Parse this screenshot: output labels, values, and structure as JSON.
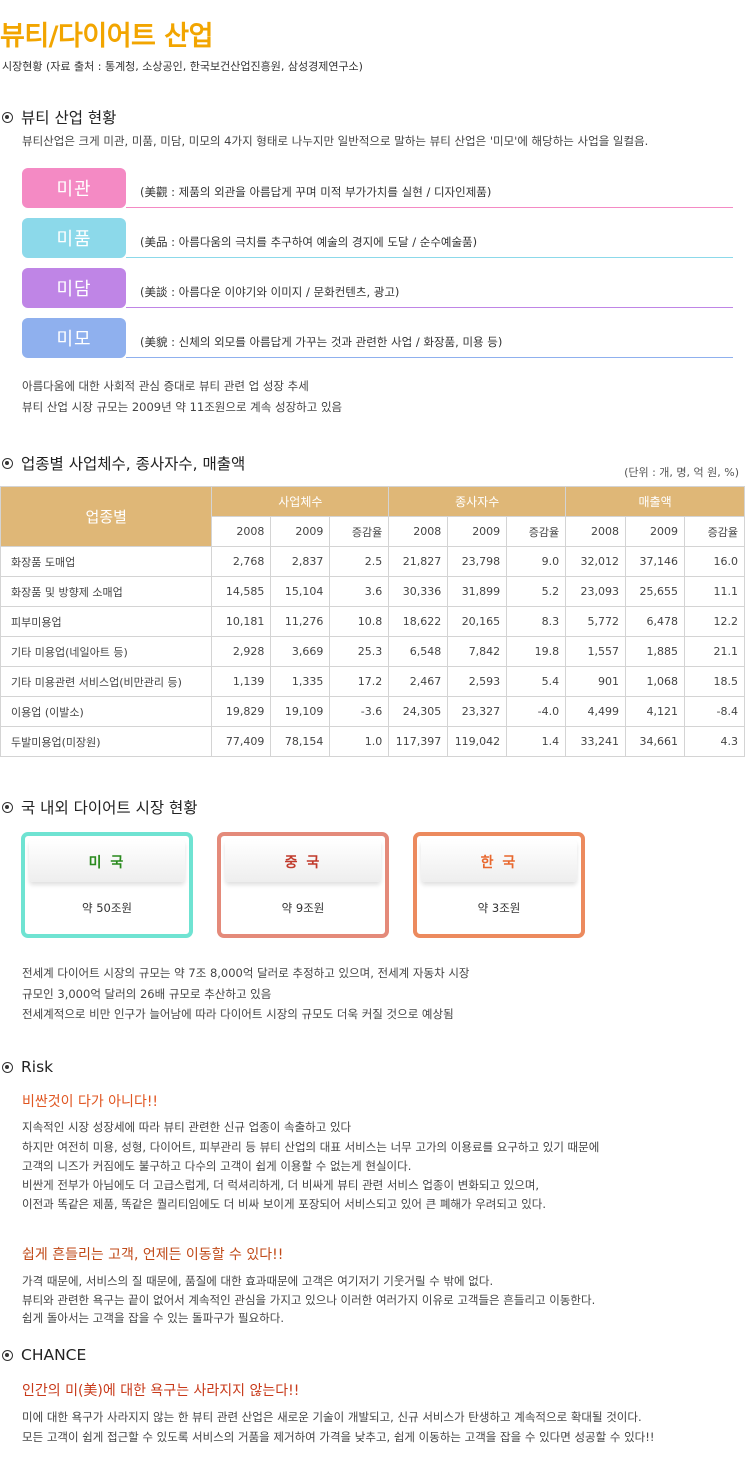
{
  "title": "뷰티/다이어트 산업",
  "subtitle": "시장현황 (자료 출처 : 통계청, 소상공인, 한국보건산업진흥원, 삼성경제연구소)",
  "beauty": {
    "heading": "뷰티 산업 현황",
    "intro": "뷰티산업은 크게 미관, 미품, 미담, 미모의 4가지 형태로 나누지만 일반적으로 말하는 뷰티 산업은 '미모'에 해당하는 사업을 일컬음.",
    "items": [
      {
        "label": "미관",
        "desc": "(美觀 : 제품의 외관을 아름답게 꾸며 미적 부가가치를 실현 / 디자인제품)",
        "color": "#f48ac4"
      },
      {
        "label": "미품",
        "desc": "(美品 : 아름다움의 극치를 추구하여 예술의 경지에 도달 / 순수예술품)",
        "color": "#8cd9ea"
      },
      {
        "label": "미담",
        "desc": "(美談 : 아름다운 이야기와 이미지 / 문화컨텐츠, 광고)",
        "color": "#bf85e6"
      },
      {
        "label": "미모",
        "desc": "(美貌 : 신체의 외모를 아름답게 가꾸는 것과 관련한 사업 / 화장품, 미용 등)",
        "color": "#8fb0ee"
      }
    ],
    "notes": [
      "아름다움에 대한 사회적 관심 증대로 뷰티 관련 업 성장 추세",
      "뷰티 산업 시장 규모는 2009년 약 11조원으로 계속 성장하고 있음"
    ]
  },
  "stats": {
    "heading": "업종별 사업체수, 종사자수, 매출액",
    "unit": "(단위 : 개, 명, 억 원, %)",
    "col_main": "업종별",
    "groups": [
      "사업체수",
      "종사자수",
      "매출액"
    ],
    "subcols": [
      "2008",
      "2009",
      "증감율",
      "2008",
      "2009",
      "증감율",
      "2008",
      "2009",
      "증감율"
    ],
    "rows": [
      {
        "name": "화장품 도매업",
        "v": [
          "2,768",
          "2,837",
          "2.5",
          "21,827",
          "23,798",
          "9.0",
          "32,012",
          "37,146",
          "16.0"
        ]
      },
      {
        "name": "화장품 및 방향제 소매업",
        "v": [
          "14,585",
          "15,104",
          "3.6",
          "30,336",
          "31,899",
          "5.2",
          "23,093",
          "25,655",
          "11.1"
        ]
      },
      {
        "name": "피부미용업",
        "v": [
          "10,181",
          "11,276",
          "10.8",
          "18,622",
          "20,165",
          "8.3",
          "5,772",
          "6,478",
          "12.2"
        ]
      },
      {
        "name": "기타 미용업(네일아트 등)",
        "v": [
          "2,928",
          "3,669",
          "25.3",
          "6,548",
          "7,842",
          "19.8",
          "1,557",
          "1,885",
          "21.1"
        ]
      },
      {
        "name": "기타 미용관련 서비스업(비만관리 등)",
        "v": [
          "1,139",
          "1,335",
          "17.2",
          "2,467",
          "2,593",
          "5.4",
          "901",
          "1,068",
          "18.5"
        ]
      },
      {
        "name": "이용업 (이발소)",
        "v": [
          "19,829",
          "19,109",
          "-3.6",
          "24,305",
          "23,327",
          "-4.0",
          "4,499",
          "4,121",
          "-8.4"
        ]
      },
      {
        "name": "두발미용업(미장원)",
        "v": [
          "77,409",
          "78,154",
          "1.0",
          "117,397",
          "119,042",
          "1.4",
          "33,241",
          "34,661",
          "4.3"
        ]
      }
    ]
  },
  "diet": {
    "heading": "국 내외 다이어트 시장 현황",
    "cards": [
      {
        "name": "미 국",
        "value": "약 50조원",
        "border": "#6fe3d2",
        "color": "#2a8a1e"
      },
      {
        "name": "중 국",
        "value": "약 9조원",
        "border": "#e48a7a",
        "color": "#c0392b"
      },
      {
        "name": "한 국",
        "value": "약 3조원",
        "border": "#ec8a5e",
        "color": "#e8682e"
      }
    ],
    "notes": [
      "전세계 다이어트 시장의 규모는 약 7조 8,000억 달러로 추정하고 있으며, 전세계 자동차 시장",
      "규모인 3,000억 달러의 26배 규모로 추산하고 있음",
      "전세계적으로 비만 인구가 늘어남에 따라 다이어트 시장의 규모도 더욱 커질 것으로 예상됨"
    ]
  },
  "risk": {
    "heading": "Risk",
    "sub1": "비싼것이 다가 아니다!!",
    "para1": [
      "지속적인 시장 성장세에 따라 뷰티 관련한 신규 업종이 속출하고 있다",
      "하지만 여전히 미용, 성형, 다이어트, 피부관리 등 뷰티 산업의 대표 서비스는 너무 고가의 이용료를 요구하고 있기 때문에",
      "고객의 니즈가 커짐에도 불구하고 다수의 고객이 쉽게 이용할 수 없는게 현실이다.",
      "비싼게 전부가 아님에도 더 고급스럽게, 더 럭셔리하게, 더 비싸게 뷰티 관련 서비스 업종이 변화되고 있으며,",
      "이전과 똑같은 제품, 똑같은 퀄리티임에도 더 비싸 보이게 포장되어 서비스되고 있어 큰 폐해가 우려되고 있다."
    ],
    "sub2": "쉽게 흔들리는 고객, 언제든 이동할 수 있다!!",
    "para2": [
      "가격 때문에, 서비스의 질 때문에, 품질에 대한 효과때문에 고객은 여기저기 기웃거릴 수 밖에 없다.",
      "뷰티와 관련한 욕구는 끝이 없어서 계속적인 관심을 가지고 있으나 이러한 여러가지 이유로 고객들은 흔들리고 이동한다.",
      "쉽게 돌아서는 고객을 잡을 수 있는 돌파구가 필요하다."
    ]
  },
  "chance": {
    "heading": "CHANCE",
    "sub": "인간의 미(美)에 대한 욕구는 사라지지 않는다!!",
    "para": [
      "미에 대한 욕구가 사라지지 않는 한 뷰티 관련 산업은 새로운 기술이 개발되고, 신규 서비스가 탄생하고 계속적으로 확대될 것이다.",
      "모든 고객이 쉽게 접근할 수 있도록 서비스의 거품을 제거하여 가격을 낮추고, 쉽게 이동하는 고객을 잡을 수 있다면 성공할 수 있다!!"
    ]
  }
}
